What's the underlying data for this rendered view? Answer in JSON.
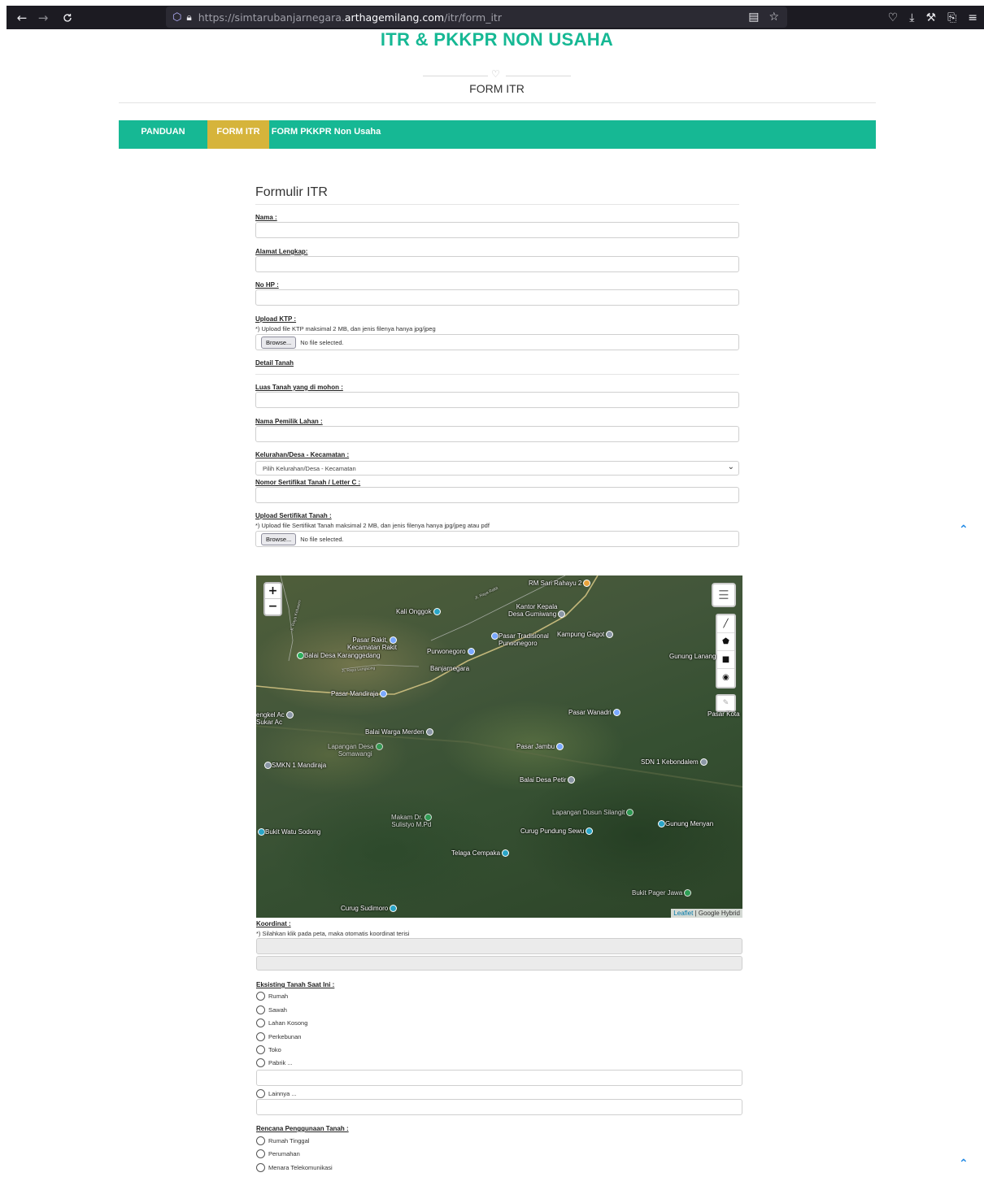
{
  "browser": {
    "back_icon": "←",
    "forward_icon": "→",
    "reload_icon": "C",
    "url_prefix": "https://simtarubanjarnegara.",
    "url_host": "arthagemilang.com",
    "url_path": "/itr/form_itr"
  },
  "header": {
    "site_title": "ITR & PKKPR NON USAHA",
    "section_subtitle": "FORM ITR"
  },
  "tabs": [
    {
      "label": "PANDUAN"
    },
    {
      "label": "FORM ITR"
    },
    {
      "label": "FORM PKKPR Non Usaha"
    }
  ],
  "form": {
    "title": "Formulir ITR",
    "nama_label": "Nama :",
    "alamat_label": "Alamat Lengkap:",
    "hp_label": "No HP :",
    "ktp_label": "Upload KTP :",
    "ktp_help": "*) Upload file KTP maksimal 2 MB, dan jenis filenya hanya jpg/jpeg",
    "browse_label": "Browse...",
    "no_file_label": "No file selected.",
    "detail_label": "Detail Tanah",
    "luas_label": "Luas Tanah yang di mohon :",
    "pemilik_label": "Nama Pemilik Lahan :",
    "kelurahan_label": "Kelurahan/Desa - Kecamatan :",
    "kelurahan_selected": "Pilih Kelurahan/Desa - Kecamatan",
    "sertifikat_no_label": "Nomor Sertifikat Tanah / Letter C :",
    "sertifikat_upload_label": "Upload Sertifikat Tanah :",
    "sertifikat_help": "*) Upload file Sertifikat Tanah maksimal 2 MB, dan jenis filenya hanya jpg/jpeg atau pdf",
    "koordinat_label": "Koordinat :",
    "koordinat_help": "*) Silahkan klik pada peta, maka otomatis koordinat terisi",
    "eksisting_label": "Eksisting Tanah Saat Ini :",
    "eksisting_options": [
      "Rumah",
      "Sawah",
      "Lahan Kosong",
      "Perkebunan",
      "Toko",
      "Pabrik ...",
      "Lainnya ..."
    ],
    "rencana_label": "Rencana Penggunaan Tanah :",
    "rencana_options": [
      "Rumah Tinggal",
      "Perumahan",
      "Menara Telekomunikasi"
    ]
  },
  "map": {
    "zoom_in": "+",
    "zoom_out": "−",
    "attribution_link": "Leaflet",
    "attribution_text": " | Google Hybrid",
    "places": {
      "rm_sari": "RM Sari Rahayu 2",
      "kali_onggok": "Kali Onggok",
      "kantor_kepala": "Kantor Kepala",
      "desa_gumiwang": "Desa Gumiwang",
      "pasar_rakit": "Pasar Rakit,",
      "kec_rakit": "Kecamatan Rakit",
      "pasar_trad": "Pasar Tradisional",
      "purwonegoro_sub": "Purwonegoro",
      "kampung_gagot": "Kampung Gagot",
      "balai_karanggedang": "Balai Desa Karanggedang",
      "purwonegoro": "Purwonegoro",
      "banjarnegara": "Banjarnegara",
      "gunung_lanang": "Gunung Lanang",
      "pasar_mandiraja": "Pasar Mandiraja",
      "pasar_wanadri": "Pasar Wanadri",
      "pasar_kota": "Pasar Kota",
      "engkel": "engkel Ac",
      "sukar": "Sukar Ac",
      "balai_merden": "Balai Warga Merden",
      "lapangan_somawangi": "Lapangan Desa",
      "somawangi": "Somawangi",
      "pasar_jambu": "Pasar Jambu",
      "smkn": "SMKN 1 Mandiraja",
      "sdn": "SDN 1 Kebondalem",
      "balai_petir": "Balai Desa Petir",
      "lapangan_silangit": "Lapangan Dusun Silangit",
      "makam": "Makam Dr.",
      "sulistyo": "Sulistyo M.Pd",
      "bukit_watu": "Bukit Watu Sodong",
      "curug_pundung": "Curug Pundung Sewu",
      "gunung_menyan": "Gunung Menyan",
      "telaga": "Telaga Cempaka",
      "bukit_pager": "Bukit Pager Jawa",
      "curug_sudimoro": "Curug Sudimoro",
      "road_raya_rakit": "Jl. Raya Rakit",
      "road_raya_kebasen": "Jl. Raya Kebasen",
      "road_lengkong": "Jl. Raya Lengkong"
    }
  }
}
